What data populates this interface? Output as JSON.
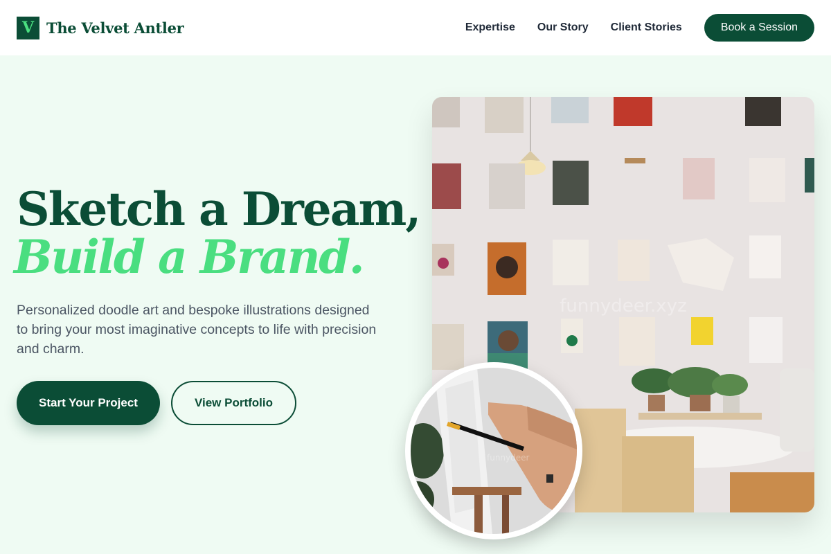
{
  "brand": {
    "logo_letter": "V",
    "name": "The Velvet Antler"
  },
  "nav": {
    "links": [
      "Expertise",
      "Our Story",
      "Client Stories"
    ],
    "cta": "Book a Session"
  },
  "hero": {
    "title_line1": "Sketch a Dream,",
    "title_line2": "Build a Brand.",
    "description": "Personalized doodle art and bespoke illustrations designed to bring your most imaginative concepts to life with precision and charm.",
    "primary_button": "Start Your Project",
    "secondary_button": "View Portfolio"
  },
  "colors": {
    "primary": "#0b4d36",
    "accent": "#4ade80",
    "background": "#effbf3",
    "body_text": "#4b5563"
  },
  "images": {
    "main": "studio-wall-with-clipboards-and-table",
    "inset": "hand-painting-on-easel"
  }
}
